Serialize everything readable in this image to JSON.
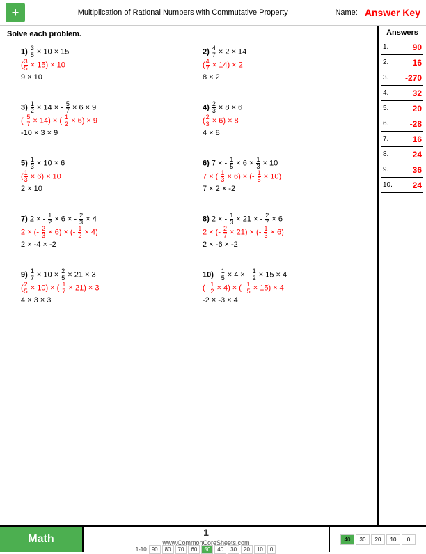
{
  "header": {
    "logo_symbol": "+",
    "title": "Multiplication of Rational Numbers with Commutative Property",
    "name_label": "Name:",
    "answer_key_label": "Answer Key"
  },
  "instruction": "Solve each problem.",
  "answers": {
    "title": "Answers",
    "items": [
      {
        "num": "1.",
        "val": "90"
      },
      {
        "num": "2.",
        "val": "16"
      },
      {
        "num": "3.",
        "val": "-270"
      },
      {
        "num": "4.",
        "val": "32"
      },
      {
        "num": "5.",
        "val": "20"
      },
      {
        "num": "6.",
        "val": "-28"
      },
      {
        "num": "7.",
        "val": "16"
      },
      {
        "num": "8.",
        "val": "24"
      },
      {
        "num": "9.",
        "val": "36"
      },
      {
        "num": "10.",
        "val": "24"
      }
    ]
  },
  "footer": {
    "math_label": "Math",
    "website": "www.CommonCoreSheets.com",
    "page": "1",
    "score_row_label": "1-10",
    "score_values": [
      "90",
      "80",
      "70",
      "60",
      "50",
      "40",
      "30",
      "20",
      "10",
      "0"
    ]
  }
}
